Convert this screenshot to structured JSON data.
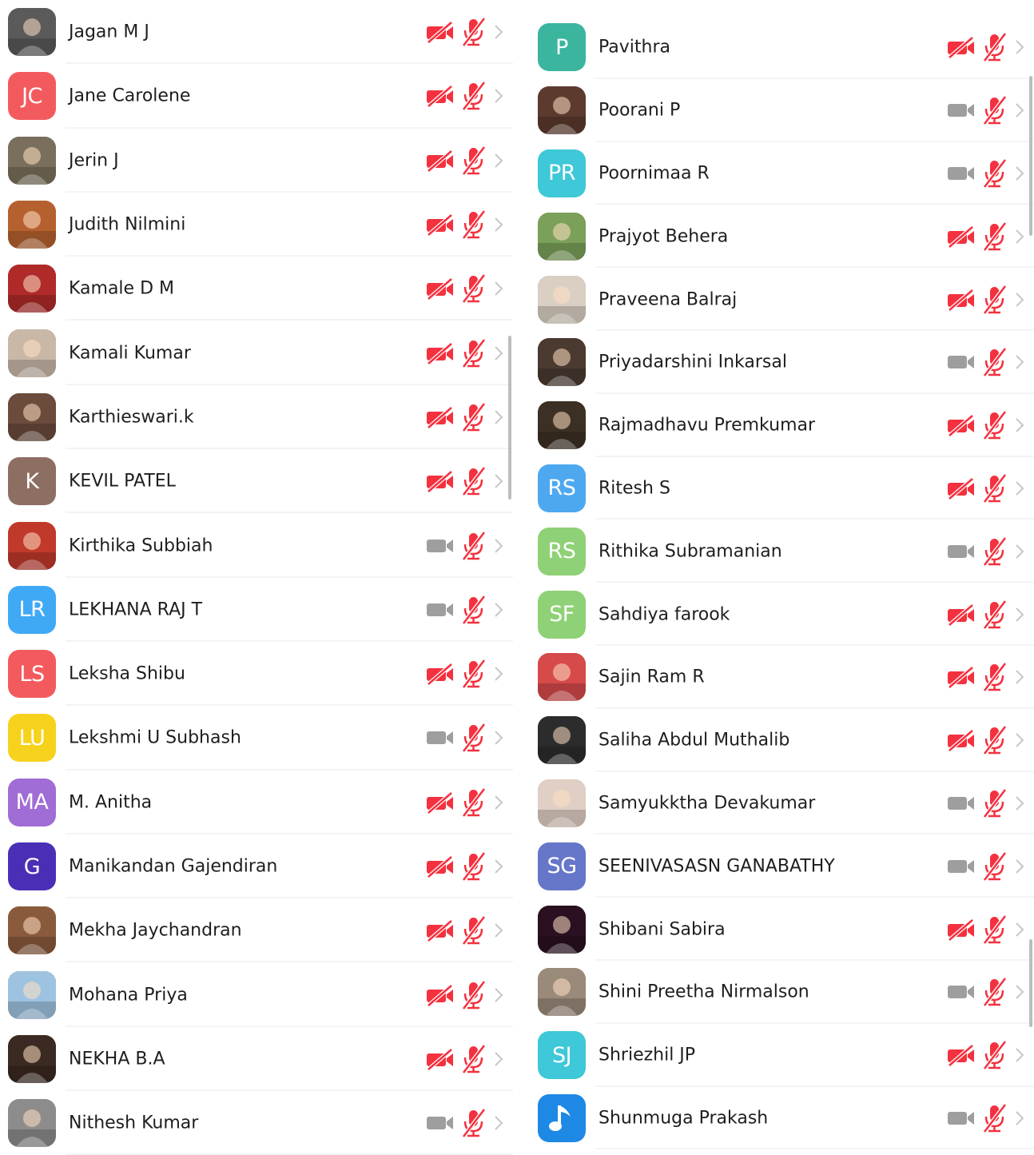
{
  "colors": {
    "muted_red": "#f4313f",
    "video_on_gray": "#9e9e9e",
    "chevron_gray": "#c7c7c7",
    "avatar_red": "#f35a5e",
    "avatar_brown": "#8d6e63",
    "avatar_blue": "#3fa9f5",
    "avatar_yellow": "#f7d21c",
    "avatar_purple": "#a06cd5",
    "avatar_indigo": "#4a2fb6",
    "avatar_teal": "#3bb59e",
    "avatar_cyan": "#3ec8d8",
    "avatar_light_blue": "#4ea8f0",
    "avatar_green": "#8fd176",
    "avatar_slate": "#6676c9"
  },
  "left_column": [
    {
      "name": "Jagan M J",
      "avatar": {
        "type": "photo",
        "tone": "#5a5a5a"
      },
      "video": "off",
      "mic": "off"
    },
    {
      "name": "Jane Carolene",
      "avatar": {
        "type": "initials",
        "initials": "JC",
        "color": "#f35a5e"
      },
      "video": "off",
      "mic": "off"
    },
    {
      "name": "Jerin J",
      "avatar": {
        "type": "photo",
        "tone": "#7a6f5c"
      },
      "video": "off",
      "mic": "off"
    },
    {
      "name": "Judith Nilmini",
      "avatar": {
        "type": "photo",
        "tone": "#b5612f"
      },
      "video": "off",
      "mic": "off"
    },
    {
      "name": "Kamale D M",
      "avatar": {
        "type": "photo",
        "tone": "#b02a2a"
      },
      "video": "off",
      "mic": "off"
    },
    {
      "name": "Kamali Kumar",
      "avatar": {
        "type": "photo",
        "tone": "#c9b8a8"
      },
      "video": "off",
      "mic": "off"
    },
    {
      "name": "Karthieswari.k",
      "avatar": {
        "type": "photo",
        "tone": "#6b4b3c"
      },
      "video": "off",
      "mic": "off"
    },
    {
      "name": "KEVIL PATEL",
      "avatar": {
        "type": "initials",
        "initials": "K",
        "color": "#8d6e63"
      },
      "video": "off",
      "mic": "off"
    },
    {
      "name": "Kirthika Subbiah",
      "avatar": {
        "type": "photo",
        "tone": "#c0392b"
      },
      "video": "on",
      "mic": "off"
    },
    {
      "name": "LEKHANA RAJ T",
      "avatar": {
        "type": "initials",
        "initials": "LR",
        "color": "#3fa9f5"
      },
      "video": "on",
      "mic": "off"
    },
    {
      "name": "Leksha Shibu",
      "avatar": {
        "type": "initials",
        "initials": "LS",
        "color": "#f35a5e"
      },
      "video": "off",
      "mic": "off"
    },
    {
      "name": "Lekshmi U Subhash",
      "avatar": {
        "type": "initials",
        "initials": "LU",
        "color": "#f7d21c"
      },
      "video": "on",
      "mic": "off"
    },
    {
      "name": "M. Anitha",
      "avatar": {
        "type": "initials",
        "initials": "MA",
        "color": "#a06cd5"
      },
      "video": "off",
      "mic": "off"
    },
    {
      "name": "Manikandan Gajendiran",
      "avatar": {
        "type": "initials",
        "initials": "G",
        "color": "#4a2fb6"
      },
      "video": "off",
      "mic": "off"
    },
    {
      "name": "Mekha Jaychandran",
      "avatar": {
        "type": "photo",
        "tone": "#8a5a3c"
      },
      "video": "off",
      "mic": "off"
    },
    {
      "name": "Mohana Priya",
      "avatar": {
        "type": "photo",
        "tone": "#9ec3e0"
      },
      "video": "off",
      "mic": "off"
    },
    {
      "name": "NEKHA B.A",
      "avatar": {
        "type": "photo",
        "tone": "#3b2a22"
      },
      "video": "off",
      "mic": "off"
    },
    {
      "name": "Nithesh Kumar",
      "avatar": {
        "type": "photo",
        "tone": "#8c8c8c"
      },
      "video": "on",
      "mic": "off"
    }
  ],
  "right_column": [
    {
      "name": "Pavithra",
      "avatar": {
        "type": "initials",
        "initials": "P",
        "color": "#3bb59e"
      },
      "video": "off",
      "mic": "off"
    },
    {
      "name": "Poorani P",
      "avatar": {
        "type": "photo",
        "tone": "#5c3a2e"
      },
      "video": "on",
      "mic": "off"
    },
    {
      "name": "Poornimaa R",
      "avatar": {
        "type": "initials",
        "initials": "PR",
        "color": "#3ec8d8"
      },
      "video": "on",
      "mic": "off"
    },
    {
      "name": "Prajyot Behera",
      "avatar": {
        "type": "photo",
        "tone": "#7aa05a"
      },
      "video": "off",
      "mic": "off"
    },
    {
      "name": "Praveena Balraj",
      "avatar": {
        "type": "photo",
        "tone": "#d9cfc2"
      },
      "video": "off",
      "mic": "off"
    },
    {
      "name": "Priyadarshini Inkarsal",
      "avatar": {
        "type": "photo",
        "tone": "#4a3a30"
      },
      "video": "on",
      "mic": "off"
    },
    {
      "name": "Rajmadhavu Premkumar",
      "avatar": {
        "type": "photo",
        "tone": "#3c3024"
      },
      "video": "off",
      "mic": "off"
    },
    {
      "name": "Ritesh S",
      "avatar": {
        "type": "initials",
        "initials": "RS",
        "color": "#4ea8f0"
      },
      "video": "off",
      "mic": "off"
    },
    {
      "name": "Rithika Subramanian",
      "avatar": {
        "type": "initials",
        "initials": "RS",
        "color": "#8fd176"
      },
      "video": "on",
      "mic": "off"
    },
    {
      "name": "Sahdiya farook",
      "avatar": {
        "type": "initials",
        "initials": "SF",
        "color": "#8fd176"
      },
      "video": "off",
      "mic": "off"
    },
    {
      "name": "Sajin Ram R",
      "avatar": {
        "type": "photo",
        "tone": "#d64a4a"
      },
      "video": "off",
      "mic": "off"
    },
    {
      "name": "Saliha Abdul Muthalib",
      "avatar": {
        "type": "photo",
        "tone": "#2c2c2c"
      },
      "video": "off",
      "mic": "off"
    },
    {
      "name": "Samyukktha Devakumar",
      "avatar": {
        "type": "photo",
        "tone": "#e0cfc4"
      },
      "video": "on",
      "mic": "off"
    },
    {
      "name": "SEENIVASASN GANABATHY",
      "avatar": {
        "type": "initials",
        "initials": "SG",
        "color": "#6676c9"
      },
      "video": "on",
      "mic": "off"
    },
    {
      "name": "Shibani Sabira",
      "avatar": {
        "type": "photo",
        "tone": "#2a1020"
      },
      "video": "off",
      "mic": "off"
    },
    {
      "name": "Shini Preetha Nirmalson",
      "avatar": {
        "type": "photo",
        "tone": "#9a8a7a"
      },
      "video": "on",
      "mic": "off"
    },
    {
      "name": "Shriezhil JP",
      "avatar": {
        "type": "initials",
        "initials": "SJ",
        "color": "#3ec8d8"
      },
      "video": "off",
      "mic": "off"
    },
    {
      "name": "Shunmuga Prakash",
      "avatar": {
        "type": "music",
        "color": "#1e88e5"
      },
      "video": "on",
      "mic": "off"
    }
  ]
}
